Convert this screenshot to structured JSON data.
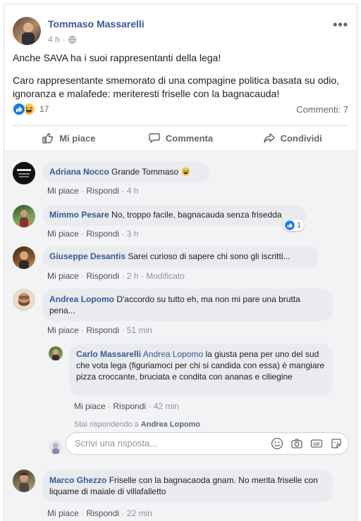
{
  "post": {
    "author": "Tommaso Massarelli",
    "time": "4 h",
    "privacy_icon": "globe-icon",
    "more_label": "•••",
    "text1": "Anche SAVA ha i suoi rappresentanti della lega!",
    "text2": "Caro rappresentante smemorato di una compagine politica basata su odio, ignoranza e malafede: meriteresti friselle con la bagnacauda!",
    "reaction_count": "17",
    "comments_count": "Commenti: 7"
  },
  "actions": {
    "like": "Mi piace",
    "comment": "Commenta",
    "share": "Condividi"
  },
  "meta_labels": {
    "like": "Mi piace",
    "reply": "Rispondi",
    "sep": "·"
  },
  "comments": [
    {
      "name": "Adriana Nocco",
      "text": "Grande Tommaso",
      "time": "4 h"
    },
    {
      "name": "Mimmo Pesare",
      "text": "No, troppo facile, bagnacauda senza frisedda",
      "time": "3 h",
      "likes": "1"
    },
    {
      "name": "Giuseppe Desantis",
      "text": "Sarei curioso di sapere chi sono gli iscritti...",
      "time": "2 h",
      "edited": "Modificato"
    },
    {
      "name": "Andrea Lopomo",
      "text": "D'accordo su tutto eh, ma non mi pare una brutta pena...",
      "time": "51 min"
    },
    {
      "name": "Marco Ghezzo",
      "text": "Friselle con la bagnacaoda gnam. No merita friselle con liquame di maiale di villafalletto",
      "time": "22 min"
    }
  ],
  "reply": {
    "name": "Carlo Massarelli",
    "mention": "Andrea Lopomo",
    "text": "la giusta pena per uno del sud che vota lega (figuriamoci per chi si candida con essa) è mangiare pizza croccante, bruciata e condita con ananas e ciliegine",
    "time": "42 min"
  },
  "replying": {
    "prefix": "Stai rispondendo a",
    "name": "Andrea Lopomo"
  },
  "reply_input": {
    "placeholder": "Scrivi una risposta..."
  },
  "colors": {
    "link": "#385898",
    "like_blue": "#1877f2",
    "muted": "#90949c",
    "bubble": "#e9ebee"
  }
}
